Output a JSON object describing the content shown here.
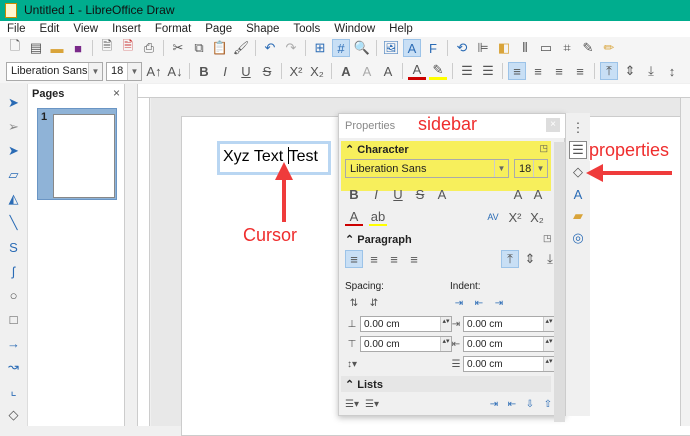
{
  "window": {
    "title": "Untitled 1 - LibreOffice Draw"
  },
  "menu": [
    "File",
    "Edit",
    "View",
    "Insert",
    "Format",
    "Page",
    "Shape",
    "Tools",
    "Window",
    "Help"
  ],
  "formatting": {
    "font_name": "Liberation Sans",
    "font_size": "18"
  },
  "pages_panel": {
    "title": "Pages",
    "close": "×",
    "page_number": "1"
  },
  "document": {
    "text_before_cursor": "Xyz Text ",
    "text_after_cursor": "Test"
  },
  "sidebar": {
    "title": "Properties",
    "close": "×",
    "character": {
      "header": "Character",
      "font_name": "Liberation Sans",
      "font_size": "18"
    },
    "paragraph": {
      "header": "Paragraph",
      "spacing_label": "Spacing:",
      "indent_label": "Indent:",
      "above": "0.00 cm",
      "below": "0.00 cm",
      "before_text": "0.00 cm",
      "after_text": "0.00 cm",
      "first_line": "0.00 cm"
    },
    "lists": {
      "header": "Lists"
    }
  },
  "annotations": {
    "sidebar": "sidebar",
    "properties": "properties",
    "cursor": "Cursor"
  },
  "colors": {
    "titlebar": "#00ad8e",
    "highlight": "#f7ef5c",
    "annotation": "#ef2d2d"
  }
}
